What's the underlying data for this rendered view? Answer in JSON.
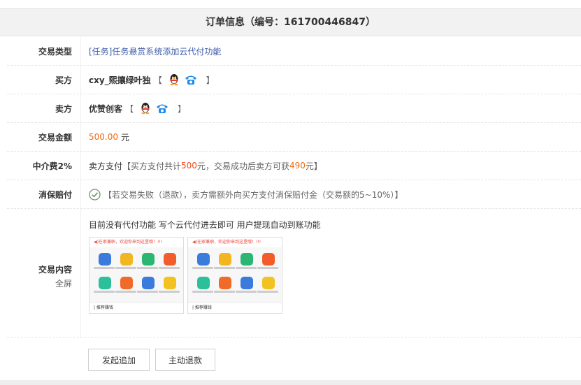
{
  "header": {
    "title": "订单信息（编号：161700446847）"
  },
  "rows": {
    "type": {
      "label": "交易类型",
      "value": "[任务]任务悬赏系统添加云代付功能"
    },
    "buyer": {
      "label": "买方",
      "name": "cxy_熙攘绿叶独",
      "open": "【",
      "close": "】"
    },
    "seller": {
      "label": "卖方",
      "name": "优赞创客",
      "open": "【",
      "close": "】"
    },
    "amount": {
      "label": "交易金额",
      "value": "500.00",
      "unit": "元"
    },
    "fee": {
      "label": "中介费2%",
      "payer": "卖方支付",
      "p1": "【买方支付共计",
      "n1": "500",
      "p2": "元，交易成功后卖方可获",
      "n2": "490",
      "p3": "元】"
    },
    "guarantee": {
      "label": "消保赔付",
      "text": "【若交易失败（退款），卖方需额外向买方支付消保赔付金（交易额的5~10%）】"
    },
    "content": {
      "label": "交易内容",
      "sublabel": "全屏",
      "text": "目前没有代付功能 写个云代付进去即可  用户提现自动到账功能",
      "thumb_banner": "◀)在家兼职，欢迎你来到这里哦！!!!",
      "thumb_footer": "| 推荐赚钱"
    }
  },
  "buttons": {
    "add": "发起追加",
    "refund": "主动退款"
  },
  "icons": {
    "qq": "qq-penguin-icon",
    "phone": "phone-icon",
    "check": "check-circle-icon"
  },
  "colors": {
    "link": "#3b5aa8",
    "amount": "#f06b0f",
    "highlight": "#f04b1f",
    "phone": "#1e8be6"
  }
}
